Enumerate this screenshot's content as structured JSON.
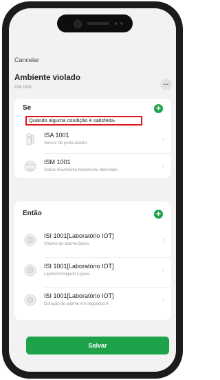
{
  "header": {
    "cancel_label": "Cancelar",
    "title": "Ambiente violado",
    "subtitle": "Dia todo",
    "more_label": "..."
  },
  "condition_card": {
    "title": "Se",
    "mode_label": "Quando alguma condição é satisfeita",
    "items": [
      {
        "name": "ISA 1001",
        "desc": "Sensor de porta:Aberto",
        "icon": "door-sensor-icon"
      },
      {
        "name": "ISM 1001",
        "desc": "Status movimento:Movimento detectado.",
        "icon": "motion-sensor-icon"
      }
    ]
  },
  "action_card": {
    "title": "Então",
    "items": [
      {
        "name": "ISI 1001[Laboratório IOT]",
        "desc": "Volume do alarme:Baixo",
        "icon": "siren-icon"
      },
      {
        "name": "ISI 1001[Laboratório IOT]",
        "desc": "Ligado/Desligado:Ligada",
        "icon": "siren-icon"
      },
      {
        "name": "ISI 1001[Laboratório IOT]",
        "desc": "Duração do alarme em segundos:4.",
        "icon": "siren-icon"
      }
    ]
  },
  "save_label": "Salvar",
  "colors": {
    "accent": "#1fa34a",
    "highlight": "#e0141b",
    "background": "#f2f2f2"
  }
}
